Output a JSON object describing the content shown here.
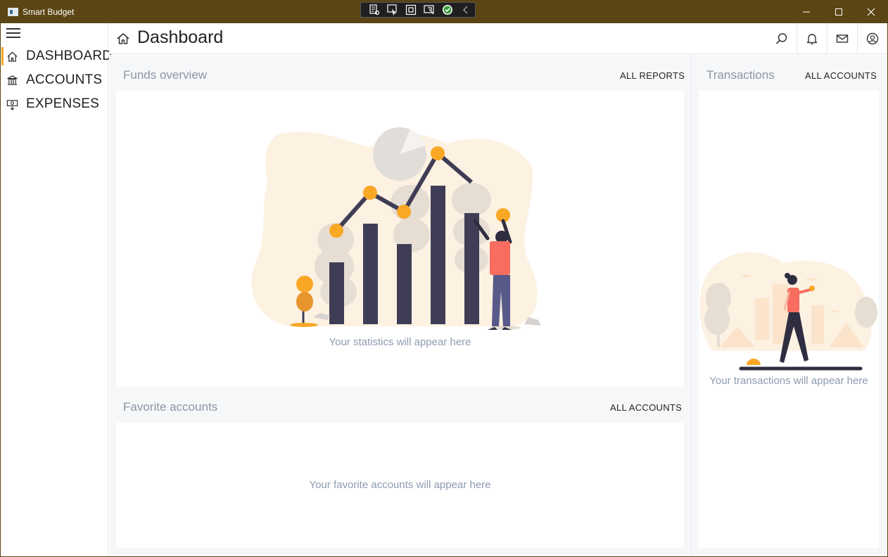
{
  "window": {
    "title": "Smart Budget",
    "controls": {
      "minimize": "minimize-icon",
      "maximize": "maximize-icon",
      "close": "close-icon"
    }
  },
  "sidebar": {
    "items": [
      {
        "label": "DASHBOARD",
        "icon": "home-icon",
        "active": true
      },
      {
        "label": "ACCOUNTS",
        "icon": "bank-icon",
        "active": false
      },
      {
        "label": "EXPENSES",
        "icon": "expenses-icon",
        "active": false
      }
    ]
  },
  "header": {
    "title": "Dashboard",
    "actions": [
      "search-icon",
      "bell-icon",
      "mail-icon",
      "user-icon"
    ]
  },
  "funds": {
    "title": "Funds overview",
    "link": "ALL REPORTS",
    "placeholder": "Your statistics will appear here"
  },
  "favorites": {
    "title": "Favorite accounts",
    "link": "ALL ACCOUNTS",
    "placeholder": "Your favorite accounts will appear here"
  },
  "transactions": {
    "title": "Transactions",
    "link": "ALL ACCOUNTS",
    "placeholder": "Your transactions will appear here"
  },
  "colors": {
    "titlebar": "#5c4514",
    "accent": "#f5a623",
    "dark": "#3f3d56",
    "person": "#f86d5f",
    "blob": "#fdf1e2"
  }
}
